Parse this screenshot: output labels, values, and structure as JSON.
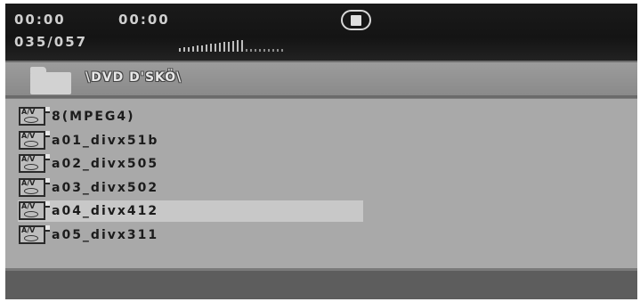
{
  "status": {
    "elapsed_time": "00:00",
    "total_time": "00:00",
    "track_counter": "035/057",
    "progress_fraction": 0.63,
    "playback_state_icon": "stop-icon"
  },
  "path": {
    "folder_icon": "folder-icon",
    "text": "\\DVD D'SKÖ\\"
  },
  "files": [
    {
      "icon": "av-file-icon",
      "icon_label": "A/V",
      "name": "8(MPEG4)",
      "selected": false
    },
    {
      "icon": "av-file-icon",
      "icon_label": "A/V",
      "name": "a01_divx51b",
      "selected": false
    },
    {
      "icon": "av-file-icon",
      "icon_label": "A/V",
      "name": "a02_divx505",
      "selected": false
    },
    {
      "icon": "av-file-icon",
      "icon_label": "A/V",
      "name": "a03_divx502",
      "selected": false
    },
    {
      "icon": "av-file-icon",
      "icon_label": "A/V",
      "name": "a04_divx412",
      "selected": true
    },
    {
      "icon": "av-file-icon",
      "icon_label": "A/V",
      "name": "a05_divx311",
      "selected": false
    }
  ]
}
